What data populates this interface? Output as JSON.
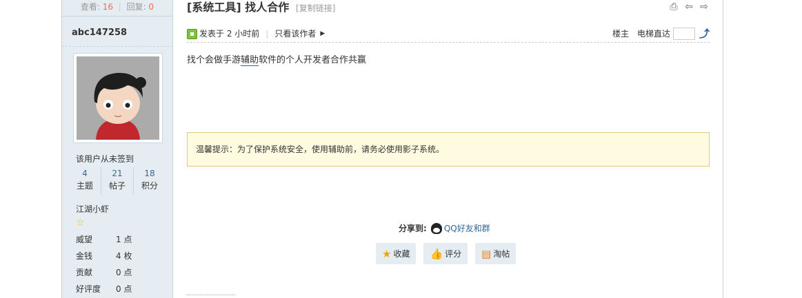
{
  "sidebar": {
    "views_label": "查看:",
    "views": "16",
    "replies_label": "回复:",
    "replies": "0",
    "username": "abc147258",
    "sign_status": "该用户从未签到",
    "stats": [
      {
        "value": "4",
        "label": "主题"
      },
      {
        "value": "21",
        "label": "帖子"
      },
      {
        "value": "18",
        "label": "积分"
      }
    ],
    "rank": "江湖小虾",
    "star_icon": "star-icon",
    "info": [
      {
        "key": "威望",
        "value": "1 点"
      },
      {
        "key": "金钱",
        "value": "4 枚"
      },
      {
        "key": "贡献",
        "value": "0 点"
      },
      {
        "key": "好评度",
        "value": "0 点"
      }
    ]
  },
  "thread": {
    "title": "[系统工具] 找人合作",
    "copy_link": "[复制链接]",
    "posted_time": "发表于 2 小时前",
    "author_only": "只看该作者",
    "floor_label": "楼主",
    "goto_label": "电梯直达",
    "goto_value": "",
    "body_before": "找个会做手游",
    "body_keyword": "辅助",
    "body_after": "软件的个人开发者合作共赢",
    "tip": "温馨提示：为了保护系统安全，使用辅助前，请务必使用影子系统。",
    "share_label": "分享到:",
    "share_qq": "QQ好友和群",
    "actions": {
      "favorite": "收藏",
      "rate": "评分",
      "tao": "淘帖"
    }
  },
  "colors": {
    "sidebar_bg": "#e5edf2",
    "accent_red": "#f26c4f",
    "link_blue": "#336699",
    "tip_bg": "#fefbe0",
    "tip_border": "#e4c67f"
  }
}
